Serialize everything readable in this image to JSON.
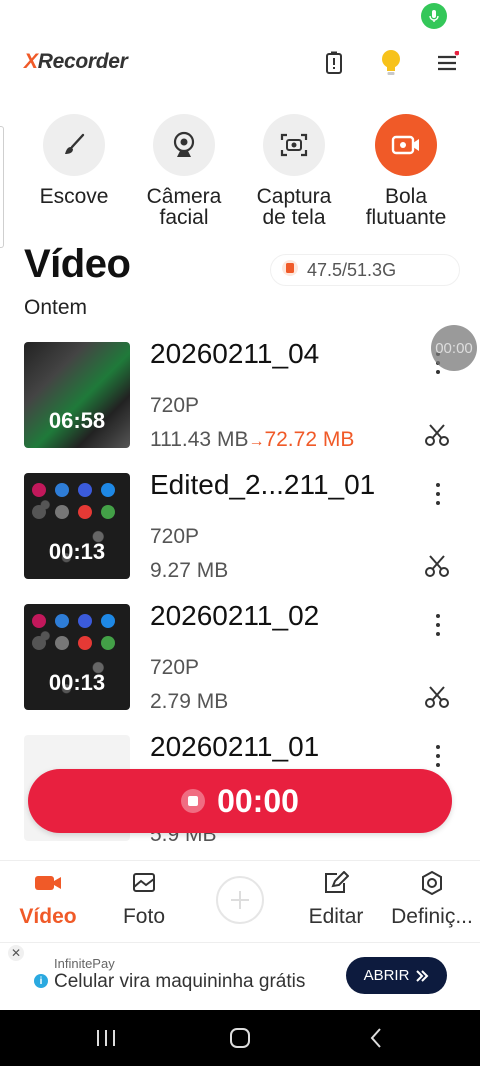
{
  "app": {
    "logo_x": "X",
    "logo_rest": "Recorder"
  },
  "tools": [
    {
      "label": "Escove",
      "icon": "brush-icon",
      "active": false
    },
    {
      "label": "Câmera facial",
      "icon": "webcam-icon",
      "active": false
    },
    {
      "label": "Captura de tela",
      "icon": "screenshot-icon",
      "active": false
    },
    {
      "label": "Bola flutuante",
      "icon": "floating-video-icon",
      "active": true
    }
  ],
  "section": {
    "title": "Vídeo",
    "storage": "47.5/51.3G",
    "date_label": "Ontem"
  },
  "floating_timer": "00:00",
  "videos": [
    {
      "title": "20260211_04",
      "duration": "06:58",
      "resolution": "720P",
      "size": "111.43 MB",
      "compressed_size": "72.72 MB"
    },
    {
      "title": "Edited_2...211_01",
      "duration": "00:13",
      "resolution": "720P",
      "size": "9.27 MB"
    },
    {
      "title": "20260211_02",
      "duration": "00:13",
      "resolution": "720P",
      "size": "2.79 MB"
    },
    {
      "title": "20260211_01",
      "duration": "",
      "resolution": "",
      "size": "5.9 MB"
    }
  ],
  "record": {
    "time": "00:00"
  },
  "nav": [
    {
      "label": "Vídeo",
      "icon": "video-camera-icon",
      "active": true
    },
    {
      "label": "Foto",
      "icon": "photo-icon",
      "active": false
    },
    {
      "label": "Editar",
      "icon": "edit-icon",
      "active": false
    },
    {
      "label": "Definiç...",
      "icon": "settings-icon",
      "active": false
    }
  ],
  "ad": {
    "brand": "InfinitePay",
    "headline": "Celular vira maquininha grátis",
    "cta": "ABRIR"
  },
  "colors": {
    "accent": "#f05a28",
    "record": "#e8203f",
    "ad_button": "#0d1b3e"
  }
}
